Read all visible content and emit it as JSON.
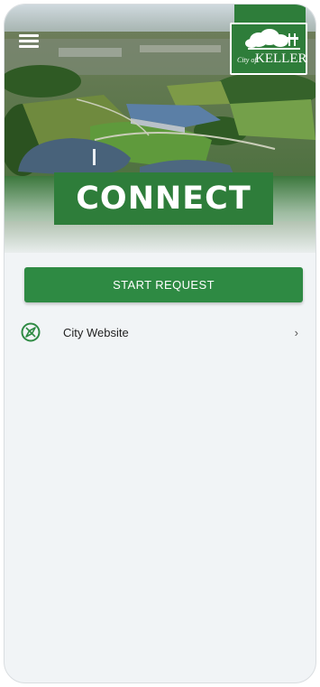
{
  "header": {
    "logo": {
      "small_text": "City of",
      "name_text": "KELLER"
    },
    "menu_icon": "hamburger-menu-icon"
  },
  "banner": {
    "title": "CONNECT"
  },
  "actions": {
    "start_request_label": "START REQUEST"
  },
  "links": [
    {
      "label": "City Website",
      "icon": "compass-icon",
      "chevron": "›"
    }
  ],
  "colors": {
    "brand_green": "#2e7d3a",
    "button_green": "#2e8a43",
    "background": "#f1f4f6"
  }
}
